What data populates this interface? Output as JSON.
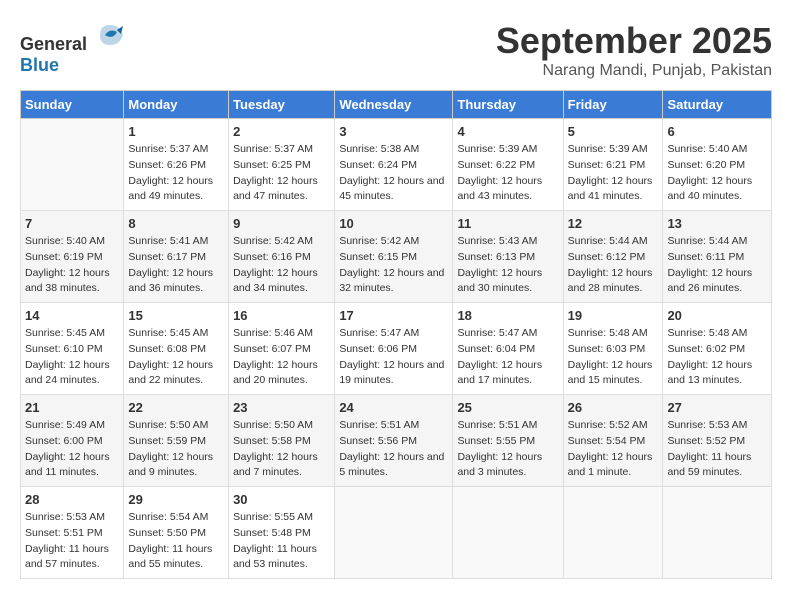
{
  "header": {
    "logo_general": "General",
    "logo_blue": "Blue",
    "month": "September 2025",
    "location": "Narang Mandi, Punjab, Pakistan"
  },
  "weekdays": [
    "Sunday",
    "Monday",
    "Tuesday",
    "Wednesday",
    "Thursday",
    "Friday",
    "Saturday"
  ],
  "weeks": [
    [
      {
        "day": "",
        "sunrise": "",
        "sunset": "",
        "daylight": ""
      },
      {
        "day": "1",
        "sunrise": "Sunrise: 5:37 AM",
        "sunset": "Sunset: 6:26 PM",
        "daylight": "Daylight: 12 hours and 49 minutes."
      },
      {
        "day": "2",
        "sunrise": "Sunrise: 5:37 AM",
        "sunset": "Sunset: 6:25 PM",
        "daylight": "Daylight: 12 hours and 47 minutes."
      },
      {
        "day": "3",
        "sunrise": "Sunrise: 5:38 AM",
        "sunset": "Sunset: 6:24 PM",
        "daylight": "Daylight: 12 hours and 45 minutes."
      },
      {
        "day": "4",
        "sunrise": "Sunrise: 5:39 AM",
        "sunset": "Sunset: 6:22 PM",
        "daylight": "Daylight: 12 hours and 43 minutes."
      },
      {
        "day": "5",
        "sunrise": "Sunrise: 5:39 AM",
        "sunset": "Sunset: 6:21 PM",
        "daylight": "Daylight: 12 hours and 41 minutes."
      },
      {
        "day": "6",
        "sunrise": "Sunrise: 5:40 AM",
        "sunset": "Sunset: 6:20 PM",
        "daylight": "Daylight: 12 hours and 40 minutes."
      }
    ],
    [
      {
        "day": "7",
        "sunrise": "Sunrise: 5:40 AM",
        "sunset": "Sunset: 6:19 PM",
        "daylight": "Daylight: 12 hours and 38 minutes."
      },
      {
        "day": "8",
        "sunrise": "Sunrise: 5:41 AM",
        "sunset": "Sunset: 6:17 PM",
        "daylight": "Daylight: 12 hours and 36 minutes."
      },
      {
        "day": "9",
        "sunrise": "Sunrise: 5:42 AM",
        "sunset": "Sunset: 6:16 PM",
        "daylight": "Daylight: 12 hours and 34 minutes."
      },
      {
        "day": "10",
        "sunrise": "Sunrise: 5:42 AM",
        "sunset": "Sunset: 6:15 PM",
        "daylight": "Daylight: 12 hours and 32 minutes."
      },
      {
        "day": "11",
        "sunrise": "Sunrise: 5:43 AM",
        "sunset": "Sunset: 6:13 PM",
        "daylight": "Daylight: 12 hours and 30 minutes."
      },
      {
        "day": "12",
        "sunrise": "Sunrise: 5:44 AM",
        "sunset": "Sunset: 6:12 PM",
        "daylight": "Daylight: 12 hours and 28 minutes."
      },
      {
        "day": "13",
        "sunrise": "Sunrise: 5:44 AM",
        "sunset": "Sunset: 6:11 PM",
        "daylight": "Daylight: 12 hours and 26 minutes."
      }
    ],
    [
      {
        "day": "14",
        "sunrise": "Sunrise: 5:45 AM",
        "sunset": "Sunset: 6:10 PM",
        "daylight": "Daylight: 12 hours and 24 minutes."
      },
      {
        "day": "15",
        "sunrise": "Sunrise: 5:45 AM",
        "sunset": "Sunset: 6:08 PM",
        "daylight": "Daylight: 12 hours and 22 minutes."
      },
      {
        "day": "16",
        "sunrise": "Sunrise: 5:46 AM",
        "sunset": "Sunset: 6:07 PM",
        "daylight": "Daylight: 12 hours and 20 minutes."
      },
      {
        "day": "17",
        "sunrise": "Sunrise: 5:47 AM",
        "sunset": "Sunset: 6:06 PM",
        "daylight": "Daylight: 12 hours and 19 minutes."
      },
      {
        "day": "18",
        "sunrise": "Sunrise: 5:47 AM",
        "sunset": "Sunset: 6:04 PM",
        "daylight": "Daylight: 12 hours and 17 minutes."
      },
      {
        "day": "19",
        "sunrise": "Sunrise: 5:48 AM",
        "sunset": "Sunset: 6:03 PM",
        "daylight": "Daylight: 12 hours and 15 minutes."
      },
      {
        "day": "20",
        "sunrise": "Sunrise: 5:48 AM",
        "sunset": "Sunset: 6:02 PM",
        "daylight": "Daylight: 12 hours and 13 minutes."
      }
    ],
    [
      {
        "day": "21",
        "sunrise": "Sunrise: 5:49 AM",
        "sunset": "Sunset: 6:00 PM",
        "daylight": "Daylight: 12 hours and 11 minutes."
      },
      {
        "day": "22",
        "sunrise": "Sunrise: 5:50 AM",
        "sunset": "Sunset: 5:59 PM",
        "daylight": "Daylight: 12 hours and 9 minutes."
      },
      {
        "day": "23",
        "sunrise": "Sunrise: 5:50 AM",
        "sunset": "Sunset: 5:58 PM",
        "daylight": "Daylight: 12 hours and 7 minutes."
      },
      {
        "day": "24",
        "sunrise": "Sunrise: 5:51 AM",
        "sunset": "Sunset: 5:56 PM",
        "daylight": "Daylight: 12 hours and 5 minutes."
      },
      {
        "day": "25",
        "sunrise": "Sunrise: 5:51 AM",
        "sunset": "Sunset: 5:55 PM",
        "daylight": "Daylight: 12 hours and 3 minutes."
      },
      {
        "day": "26",
        "sunrise": "Sunrise: 5:52 AM",
        "sunset": "Sunset: 5:54 PM",
        "daylight": "Daylight: 12 hours and 1 minute."
      },
      {
        "day": "27",
        "sunrise": "Sunrise: 5:53 AM",
        "sunset": "Sunset: 5:52 PM",
        "daylight": "Daylight: 11 hours and 59 minutes."
      }
    ],
    [
      {
        "day": "28",
        "sunrise": "Sunrise: 5:53 AM",
        "sunset": "Sunset: 5:51 PM",
        "daylight": "Daylight: 11 hours and 57 minutes."
      },
      {
        "day": "29",
        "sunrise": "Sunrise: 5:54 AM",
        "sunset": "Sunset: 5:50 PM",
        "daylight": "Daylight: 11 hours and 55 minutes."
      },
      {
        "day": "30",
        "sunrise": "Sunrise: 5:55 AM",
        "sunset": "Sunset: 5:48 PM",
        "daylight": "Daylight: 11 hours and 53 minutes."
      },
      {
        "day": "",
        "sunrise": "",
        "sunset": "",
        "daylight": ""
      },
      {
        "day": "",
        "sunrise": "",
        "sunset": "",
        "daylight": ""
      },
      {
        "day": "",
        "sunrise": "",
        "sunset": "",
        "daylight": ""
      },
      {
        "day": "",
        "sunrise": "",
        "sunset": "",
        "daylight": ""
      }
    ]
  ]
}
